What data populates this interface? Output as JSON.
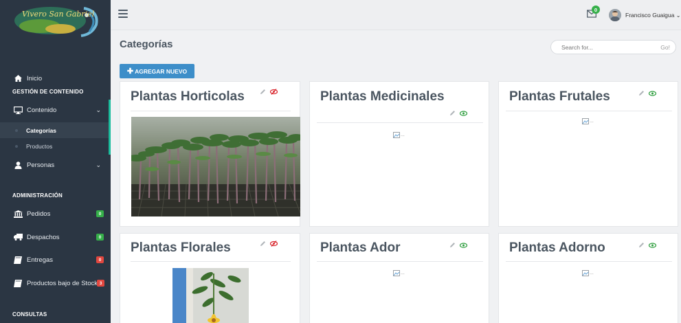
{
  "sidebar": {
    "logo_text": "Vivero San Gabriel",
    "items": [
      {
        "label": "Inicio"
      },
      {
        "section": "GESTIÓN DE CONTENIDO"
      },
      {
        "label": "Contenido"
      },
      {
        "label": "Categorías"
      },
      {
        "label": "Productos"
      },
      {
        "label": "Personas"
      },
      {
        "section": "ADMINISTRACIÓN"
      },
      {
        "label": "Pedidos",
        "badge": "0"
      },
      {
        "label": "Despachos",
        "badge": "0"
      },
      {
        "label": "Entregas",
        "badge": "0"
      },
      {
        "label": "Productos bajo de Stock",
        "badge": "3"
      },
      {
        "section": "CONSULTAS"
      }
    ]
  },
  "topbar": {
    "notification_count": "0",
    "user_name": "Francisco Guaigua"
  },
  "page": {
    "title": "Categorías",
    "search_placeholder": "Search for...",
    "search_go": "Go!",
    "add_button": "AGREGAR NUEVO",
    "broken_image_alt": "..."
  },
  "cards": [
    {
      "title": "Plantas Horticolas",
      "visibility": "hidden"
    },
    {
      "title": "Plantas Medicinales",
      "visibility": "visible"
    },
    {
      "title": "Plantas Frutales",
      "visibility": "visible"
    },
    {
      "title": "Plantas Florales",
      "visibility": "hidden"
    },
    {
      "title": "Plantas Ador",
      "visibility": "visible"
    },
    {
      "title": "Plantas Adorno",
      "visibility": "visible"
    }
  ],
  "colors": {
    "sidebar": "#2b3643",
    "accent": "#3d8ec9",
    "badge_green": "#36b04a",
    "badge_red": "#e2473f",
    "eye_visible": "#2e9e3e",
    "eye_hidden": "#d9272e"
  },
  "icons": {
    "inicio": "home-icon",
    "contenido": "desktop-icon",
    "personas": "user-icon",
    "pedidos": "bank-icon",
    "despachos": "truck-icon",
    "entregas": "book-icon",
    "stock": "book-icon",
    "menu": "hamburger-icon",
    "notifications": "envelope-icon",
    "edit": "pencil-icon",
    "visible": "eye-icon",
    "hidden": "eye-slash-icon"
  }
}
